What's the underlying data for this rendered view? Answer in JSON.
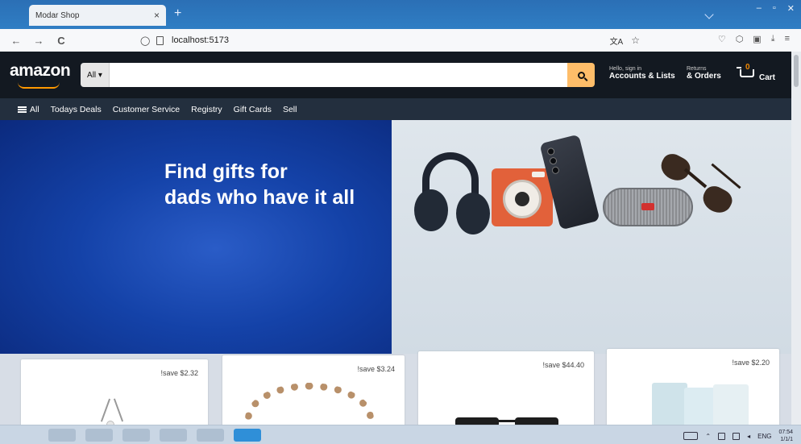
{
  "browser": {
    "tab_title": "Modar Shop",
    "tab_close": "×",
    "new_tab": "+",
    "url": "localhost:5173",
    "back": "←",
    "forward": "→",
    "reload": "C",
    "window_min": "–",
    "window_max": "▫",
    "window_close": "✕"
  },
  "header": {
    "logo": "amazon",
    "search_category": "All ▾",
    "search_placeholder": "",
    "account_small": "Hello, sign in",
    "account_big": "Accounts & Lists",
    "orders_small": "Returns",
    "orders_big": "& Orders",
    "cart_count": "0",
    "cart_label": "Cart"
  },
  "subnav": {
    "all_label": "All",
    "items": [
      "Todays Deals",
      "Customer Service",
      "Registry",
      "Gift Cards",
      "Sell"
    ]
  },
  "hero": {
    "title": "Find gifts for\ndads who have it all"
  },
  "cards": [
    {
      "save": "!save $2.32"
    },
    {
      "save": "!save $3.24"
    },
    {
      "save": "!save $44.40"
    },
    {
      "save": "!save $2.20"
    }
  ],
  "taskbar": {
    "lang": "ENG",
    "time": "07:54",
    "date": "1/1/1"
  },
  "colors": {
    "header_bg": "#131921",
    "subnav_bg": "#232f3e",
    "search_button": "#febd69",
    "logo_smile": "#ff9900",
    "hero_blue": "#1442a8"
  }
}
